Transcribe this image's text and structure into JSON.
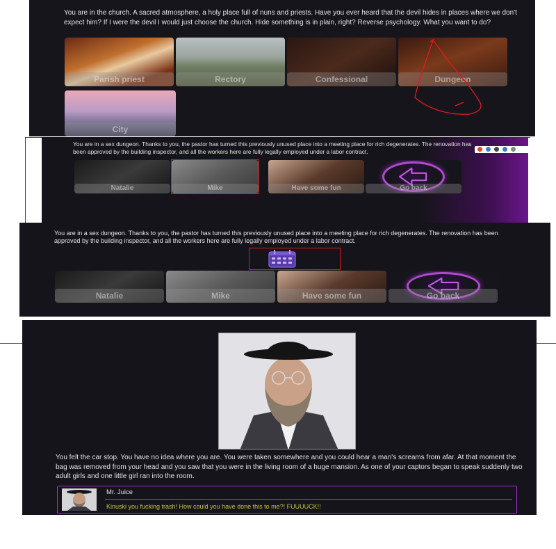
{
  "screen1": {
    "story": "You are in the church. A sacred atmosphere, a holy place full of nuns and priests. Have you ever heard that the devil hides in places where we don't expect him? If I were the devil I would just choose the church. Hide something is in plain, right? Reverse psychology. What you want to do?",
    "options": [
      "Parish priest",
      "Rectory",
      "Confessional",
      "Dungeon",
      "City"
    ]
  },
  "screen2": {
    "story": "You are in a sex dungeon. Thanks to you, the pastor has turned this previously unused place into a meeting place for rich degenerates. The renovation has been approved by the building inspector, and all the workers here are fully legally employed under a labor contract.",
    "options": [
      "Natalie",
      "Mike",
      "Have some fun",
      "Go back"
    ]
  },
  "screen3": {
    "story": "You are in a sex dungeon. Thanks to you, the pastor has turned this previously unused place into a meeting place for rich degenerates. The renovation has been approved by the building inspector, and all the workers here are fully legally employed under a labor contract.",
    "options": [
      "Natalie",
      "Mike",
      "Have some fun",
      "Go back"
    ]
  },
  "screen4": {
    "story": "You felt the car stop. You have no idea where you are. You were taken somewhere and you could hear a man's screams from afar. At that moment the bag was removed from your head and you saw that you were in the living room of a huge mansion. As one of your captors began to speak suddenly two adult girls and one little girl ran into the room.",
    "dialog": {
      "speaker": "Mr. Juice",
      "line": "Kinuski you fucking trash! How could you have done this to me?! FUUUUCK!!"
    }
  },
  "colors": {
    "panel_bg": "#17151c",
    "accent_purple": "#a12ed0",
    "annotation_red": "#e21a1a",
    "dialog_text": "#c6c23c"
  }
}
